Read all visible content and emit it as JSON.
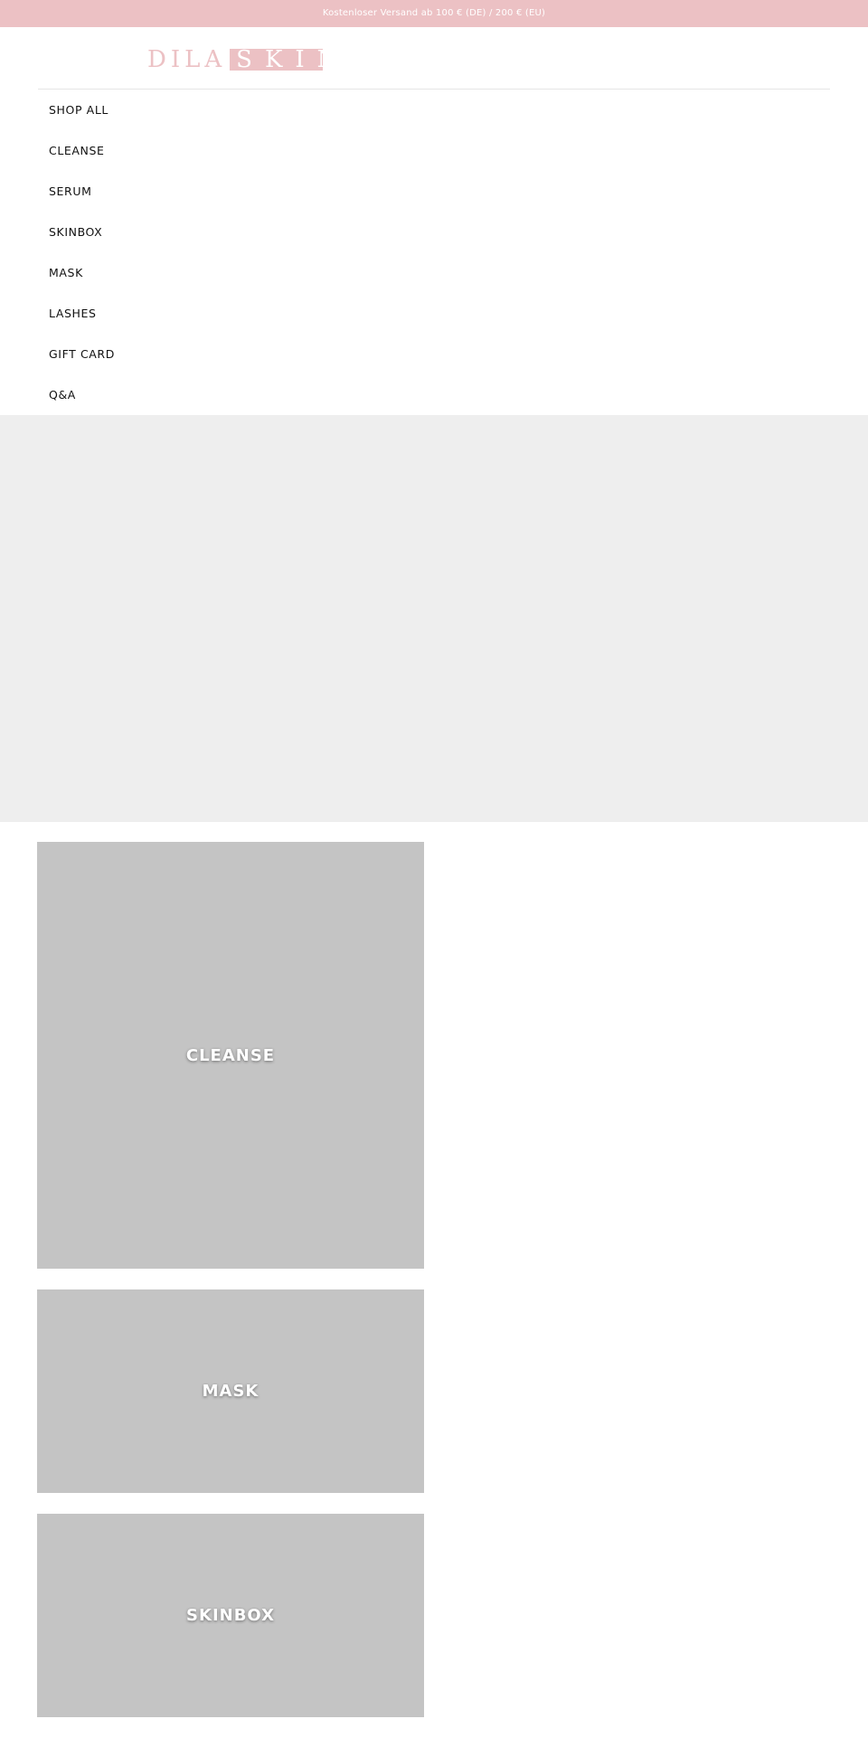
{
  "announcement": {
    "text": "Kostenloser Versand ab 100 € (DE) / 200 € (EU)"
  },
  "logo": {
    "part1": "DILA",
    "part2": "SKIN"
  },
  "nav": {
    "items": [
      {
        "label": "SHOP ALL"
      },
      {
        "label": "CLEANSE"
      },
      {
        "label": "SERUM"
      },
      {
        "label": "SKINBOX"
      },
      {
        "label": "MASK"
      },
      {
        "label": "LASHES"
      },
      {
        "label": "GIFT CARD"
      },
      {
        "label": "Q&A"
      }
    ]
  },
  "collections": [
    {
      "label": "CLEANSE"
    },
    {
      "label": "MASK"
    },
    {
      "label": "SKINBOX"
    }
  ],
  "colors": {
    "brand_pink": "#ecc1c4",
    "hero_placeholder": "#eeeeee",
    "card_placeholder": "#c4c4c4"
  }
}
